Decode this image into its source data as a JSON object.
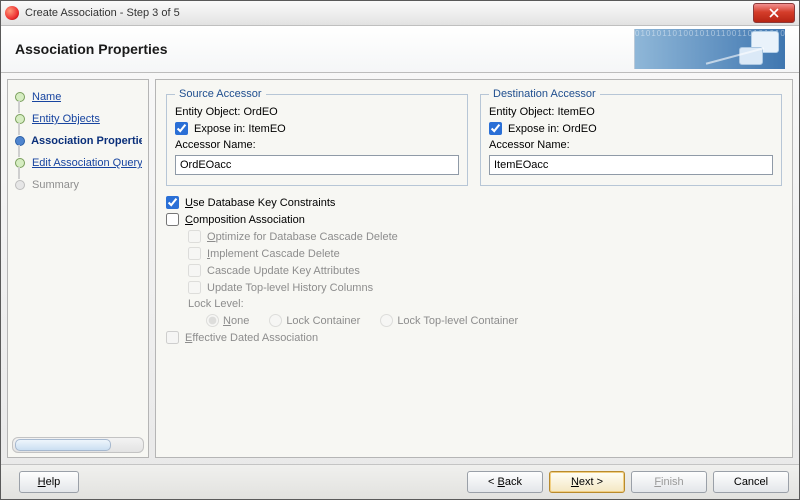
{
  "window": {
    "title": "Create Association - Step 3 of 5"
  },
  "banner": {
    "heading": "Association Properties"
  },
  "sidebar": {
    "items": [
      {
        "label": "Name"
      },
      {
        "label": "Entity Objects"
      },
      {
        "label": "Association Properties"
      },
      {
        "label": "Edit Association Query"
      },
      {
        "label": "Summary"
      }
    ]
  },
  "source": {
    "legend": "Source Accessor",
    "entity_label": "Entity Object:",
    "entity_value": "OrdEO",
    "expose_label": "Expose in: ItemEO",
    "accessor_label": "Accessor Name:",
    "accessor_value": "OrdEOacc"
  },
  "dest": {
    "legend": "Destination Accessor",
    "entity_label": "Entity Object:",
    "entity_value": "ItemEO",
    "expose_label": "Expose in: OrdEO",
    "accessor_label": "Accessor Name:",
    "accessor_value": "ItemEOacc"
  },
  "opts": {
    "use_db_key": "Use Database Key Constraints",
    "composition": "Composition Association",
    "optimize": "Optimize for Database Cascade Delete",
    "impl_cascade": "Implement Cascade Delete",
    "cascade_update": "Cascade Update Key Attributes",
    "update_history": "Update Top-level History Columns",
    "lock_level": "Lock Level:",
    "lock_none": "None",
    "lock_container": "Lock Container",
    "lock_top": "Lock Top-level Container",
    "effective": "Effective Dated Association"
  },
  "buttons": {
    "help": "Help",
    "back": "< Back",
    "next": "Next >",
    "finish": "Finish",
    "cancel": "Cancel"
  }
}
